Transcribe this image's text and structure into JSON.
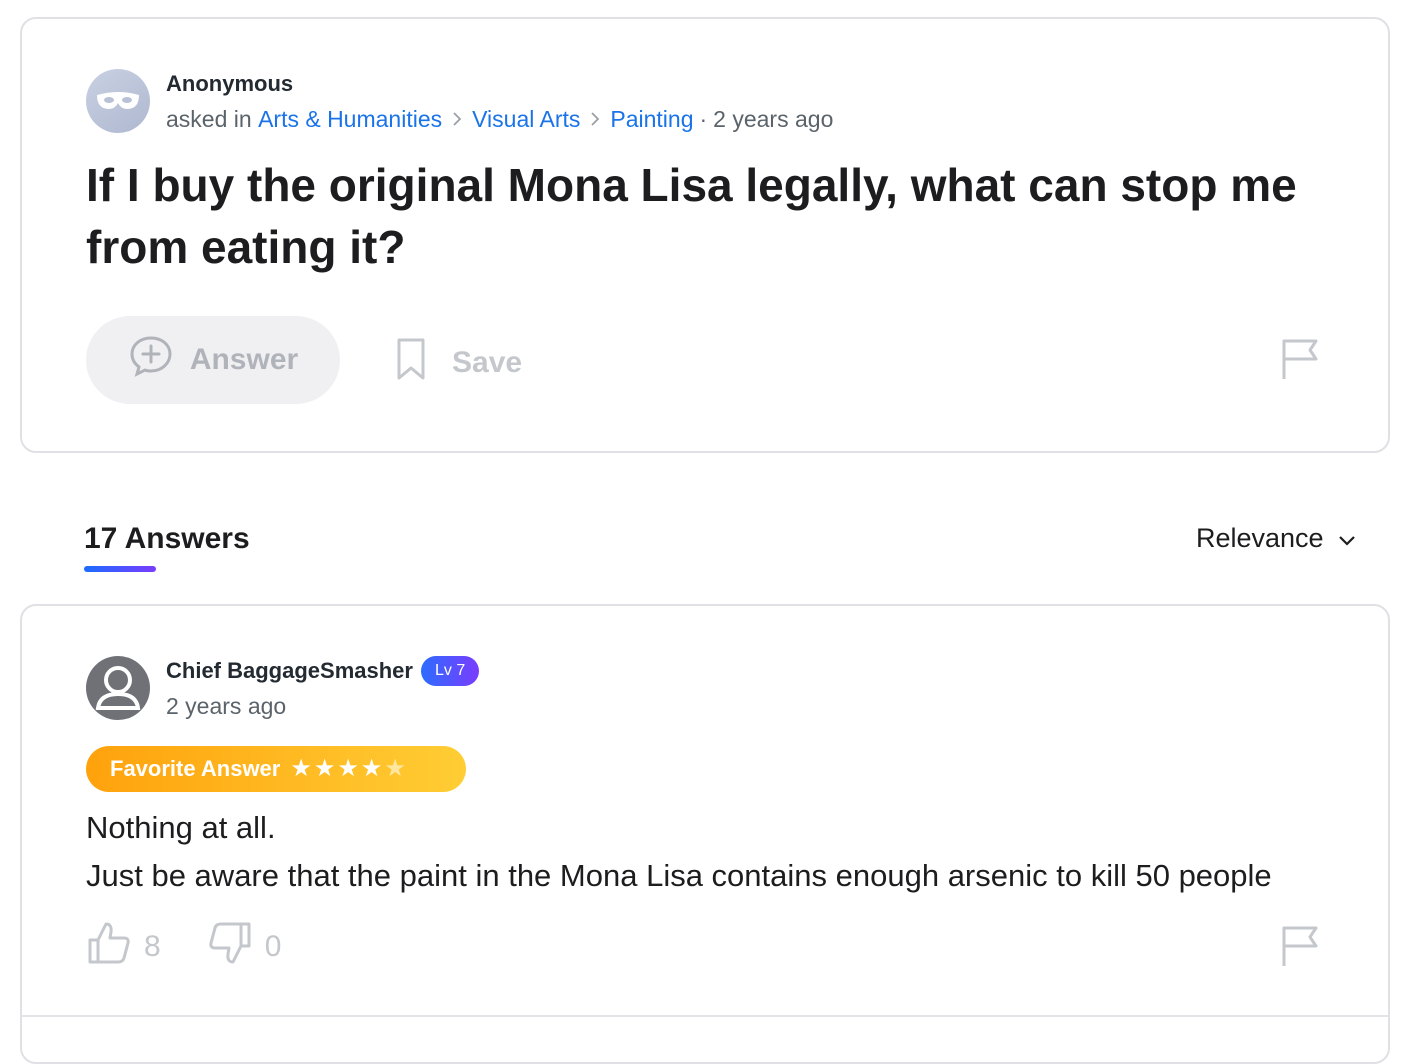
{
  "question": {
    "asker_name": "Anonymous",
    "asked_in_prefix": "asked in",
    "breadcrumbs": [
      "Arts & Humanities",
      "Visual Arts",
      "Painting"
    ],
    "time_separator": "·",
    "time": "2 years ago",
    "title": "If I buy the original Mona Lisa legally, what can stop me from eating it?",
    "answer_button": "Answer",
    "save_button": "Save"
  },
  "answers_section": {
    "count_label": "17 Answers",
    "sort_label": "Relevance"
  },
  "answer": {
    "author": "Chief BaggageSmasher",
    "level": "Lv 7",
    "time": "2 years ago",
    "favorite_label": "Favorite Answer",
    "rating": 4,
    "rating_max": 5,
    "body_lines": [
      "Nothing at all.",
      "Just be aware that the paint in the Mona Lisa contains enough arsenic to kill 50 people"
    ],
    "thumbs_up": "8",
    "thumbs_down": "0"
  },
  "colors": {
    "link": "#1a73e8",
    "badge_gradient": [
      "#2d6cff",
      "#7a3cff"
    ],
    "favorite_gradient": [
      "#ffa20c",
      "#ffcd34"
    ]
  }
}
